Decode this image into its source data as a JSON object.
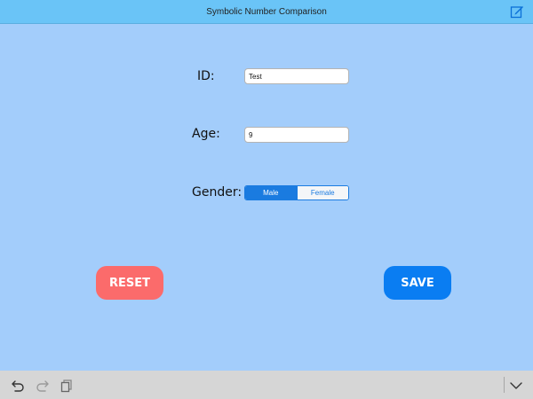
{
  "navbar": {
    "title": "Symbolic Number Comparison",
    "edit_icon": "compose-icon"
  },
  "form": {
    "id_label": "ID:",
    "id_value": "Test",
    "age_label": "Age:",
    "age_value": "9",
    "gender_label": "Gender:",
    "gender_options": [
      "Male",
      "Female"
    ],
    "gender_selected": "Male"
  },
  "buttons": {
    "reset_label": "RESET",
    "save_label": "SAVE"
  },
  "toolbar": {
    "undo_icon": "undo-icon",
    "redo_icon": "redo-icon",
    "clipboard_icon": "clipboard-icon",
    "hide_keyboard_icon": "chevron-down-icon"
  },
  "colors": {
    "background": "#a3cdfb",
    "navbar": "#6ac4f7",
    "reset": "#fb6b6b",
    "save": "#0a7df2",
    "accent": "#1a7be0"
  }
}
